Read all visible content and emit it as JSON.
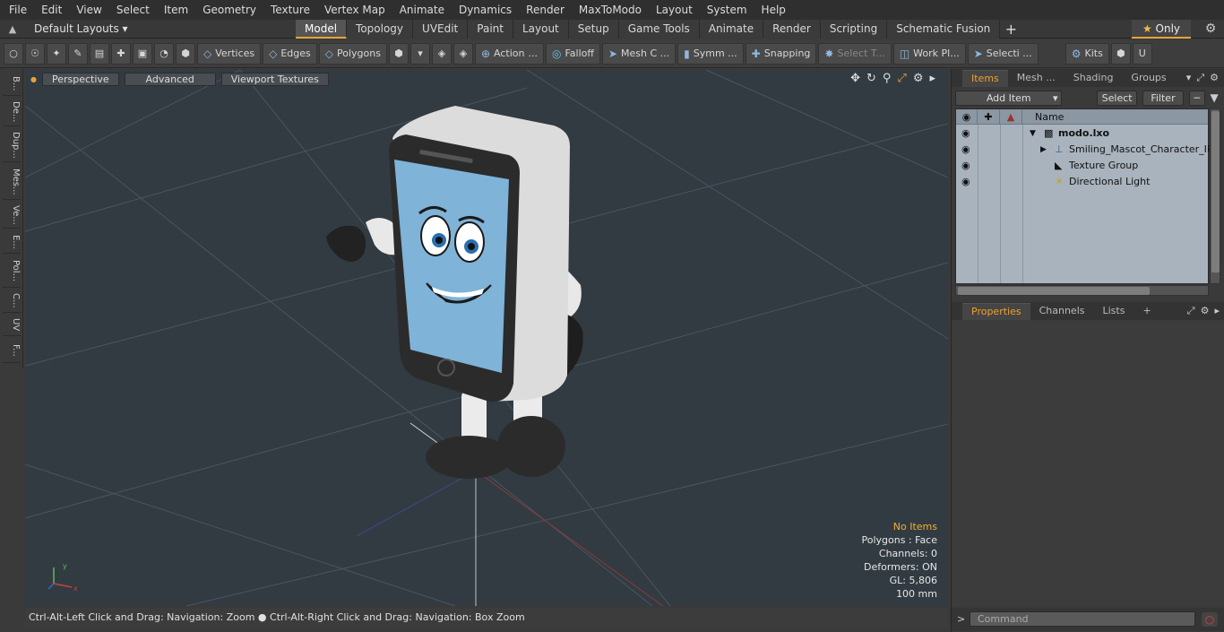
{
  "menu": [
    "File",
    "Edit",
    "View",
    "Select",
    "Item",
    "Geometry",
    "Texture",
    "Vertex Map",
    "Animate",
    "Dynamics",
    "Render",
    "MaxToModo",
    "Layout",
    "System",
    "Help"
  ],
  "layoutbar": {
    "layouts_label": "Default Layouts ▾",
    "tabs": [
      "Model",
      "Topology",
      "UVEdit",
      "Paint",
      "Layout",
      "Setup",
      "Game Tools",
      "Animate",
      "Render",
      "Scripting",
      "Schematic Fusion"
    ],
    "active_tab": "Model",
    "only_label": "Only"
  },
  "toolbar": {
    "vertices": "Vertices",
    "edges": "Edges",
    "polygons": "Polygons",
    "action": "Action",
    "falloff": "Falloff",
    "mesh_c": "Mesh C ...",
    "symm": "Symm ...",
    "snapping": "Snapping",
    "select_t": "Select T...",
    "work_pl": "Work Pl...",
    "selecti": "Selecti ...",
    "kits": "Kits"
  },
  "leftstrip": [
    "B...",
    "De...",
    "Dup...",
    "Mes...",
    "Ve...",
    "E...",
    "Pol...",
    "C...",
    "UV",
    "F..."
  ],
  "viewport": {
    "perspective": "Perspective",
    "advanced": "Advanced",
    "viewport_textures": "Viewport Textures",
    "stats": {
      "no_items": "No Items",
      "polygons": "Polygons : Face",
      "channels": "Channels: 0",
      "deformers": "Deformers: ON",
      "gl": "GL: 5,806",
      "scale": "100 mm"
    }
  },
  "statusbar": {
    "hint1": "Ctrl-Alt-Left Click and Drag: Navigation: Zoom",
    "hint2": "Ctrl-Alt-Right Click and Drag: Navigation: Box Zoom"
  },
  "items_panel": {
    "tabs": [
      "Items",
      "Mesh ...",
      "Shading",
      "Groups"
    ],
    "add_item": "Add Item",
    "select": "Select",
    "filter": "Filter",
    "name_header": "Name",
    "rows": [
      {
        "label": "modo.lxo"
      },
      {
        "label": "Smiling_Mascot_Character_IP..."
      },
      {
        "label": "Texture Group"
      },
      {
        "label": "Directional Light"
      }
    ]
  },
  "properties_panel": {
    "tabs": [
      "Properties",
      "Channels",
      "Lists"
    ]
  },
  "command": {
    "placeholder": "Command"
  },
  "colors": {
    "accent": "#e8a23a",
    "viewport_bg": "#323b42",
    "table_bg": "#a9b3bd"
  }
}
